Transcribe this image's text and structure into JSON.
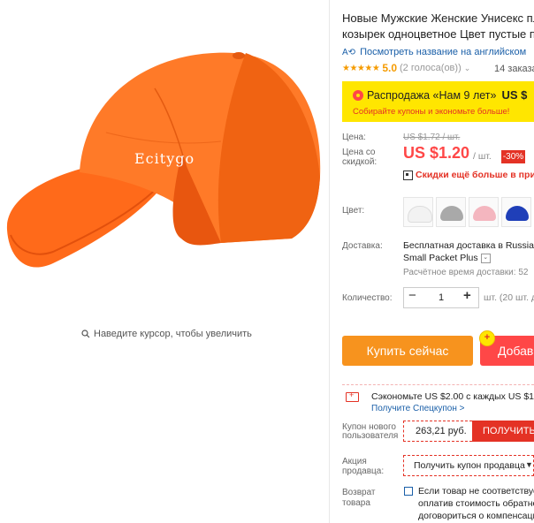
{
  "gallery": {
    "watermark": "Ecitygo",
    "zoom_hint": "Наведите курсор, чтобы увеличить"
  },
  "product": {
    "title_line1": "Новые Мужские Женские Унисекс пло",
    "title_line2": "козырек одноцветное Цвет пустые пл",
    "translate_link": "Посмотреть название на английском",
    "rating_value": "5.0",
    "rating_count": "(2 голоса(ов))",
    "orders": "14 заказа"
  },
  "sale": {
    "title": "Распродажа «Нам 9 лет»",
    "price": "US $",
    "subtitle": "Собирайте купоны и экономьте больше!"
  },
  "price": {
    "label": "Цена:",
    "old": "US $1.72 / шт.",
    "discount_label_line1": "Цена со",
    "discount_label_line2": "скидкой:",
    "new": "US $1.20",
    "unit": "/ шт.",
    "discount_badge": "-30%",
    "app_discount": "Скидки ещё больше в прило"
  },
  "color": {
    "label": "Цвет:",
    "swatches": [
      "white",
      "gray",
      "pink",
      "blue"
    ],
    "swatch_colors": [
      "#f2f2f2",
      "#a9a9a9",
      "#f4b6bf",
      "#1f3fb8"
    ]
  },
  "shipping": {
    "label": "Доставка:",
    "line1": "Бесплатная доставка в Russia",
    "line2": "Small Packet Plus",
    "time": "Расчётное время доставки: 52"
  },
  "quantity": {
    "label": "Количество:",
    "minus": "−",
    "value": "1",
    "plus": "+",
    "unit_text": "шт. (20 шт. д"
  },
  "actions": {
    "buy_now": "Купить сейчас",
    "add_to_cart": "Добав",
    "cart_badge": "+"
  },
  "coupons": {
    "save_text": "Сэкономьте US $2.00 с каждых US $15.0",
    "special_link": "Получите Спецкупон >",
    "new_user_label_line1": "Купон нового",
    "new_user_label_line2": "пользователя",
    "new_user_value": "263,21 руб.",
    "get_button": "ПОЛУЧИТЬ",
    "seller_label_line1": "Акция",
    "seller_label_line2": "продавца:",
    "seller_select": "Получить купон продавца"
  },
  "returns": {
    "label_line1": "Возврат",
    "label_line2": "товара",
    "line1": "Если товар не соответствует",
    "line2": "оплатив стоимость обратно",
    "line3": "договориться о компенсаци"
  },
  "colors": {
    "accent": "#ff4747",
    "orange_button": "#f7931e",
    "banner": "#ffe600",
    "link": "#1a5fa8",
    "cap_orange": "#ff6a1a"
  }
}
